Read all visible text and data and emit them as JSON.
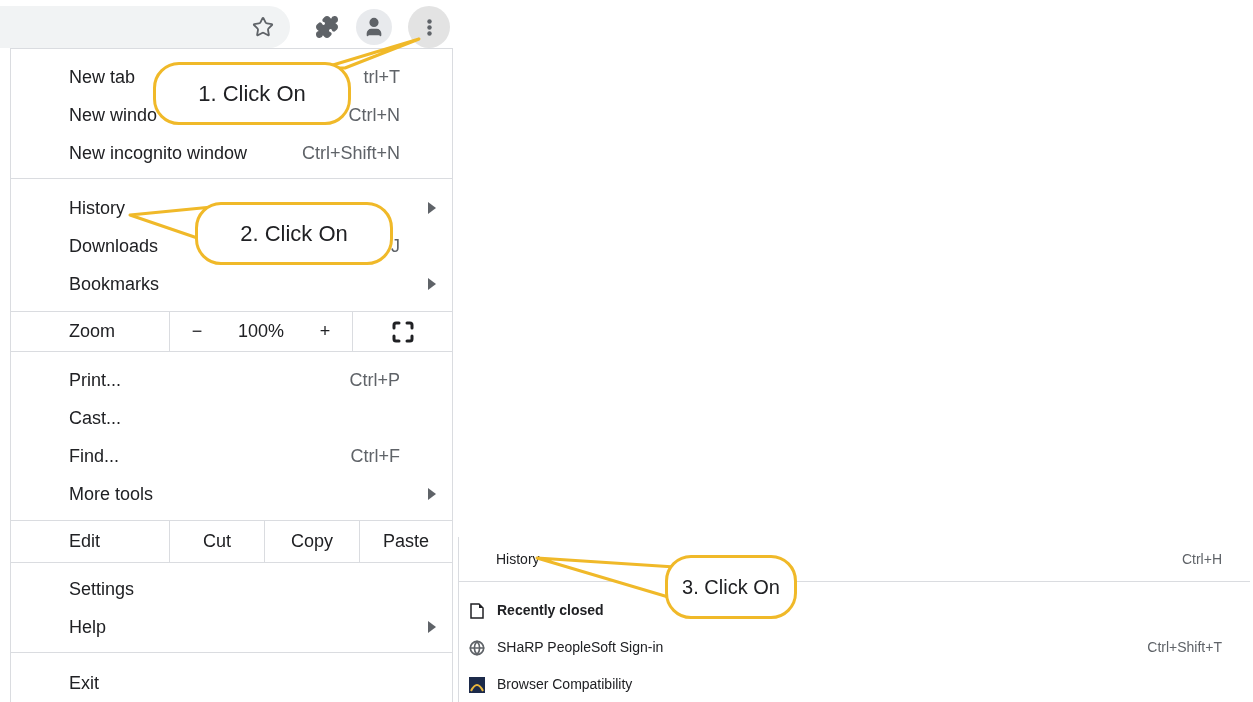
{
  "menu": {
    "sections": [
      {
        "kind": "items",
        "items": [
          {
            "label": "New tab",
            "shortcut": "trl+T",
            "submenu": false
          },
          {
            "label": "New windo",
            "shortcut": "Ctrl+N",
            "submenu": false
          },
          {
            "label": "New incognito window",
            "shortcut": "Ctrl+Shift+N",
            "submenu": false
          }
        ]
      },
      {
        "kind": "items",
        "items": [
          {
            "label": "History",
            "submenu": true
          },
          {
            "label": "Downloads",
            "shortcut": "J",
            "submenu": false
          },
          {
            "label": "Bookmarks",
            "submenu": true
          }
        ]
      },
      {
        "kind": "zoom",
        "label": "Zoom",
        "minus": "−",
        "value": "100%",
        "plus": "+"
      },
      {
        "kind": "items",
        "items": [
          {
            "label": "Print...",
            "shortcut": "Ctrl+P",
            "submenu": false
          },
          {
            "label": "Cast...",
            "submenu": false
          },
          {
            "label": "Find...",
            "shortcut": "Ctrl+F",
            "submenu": false
          },
          {
            "label": "More tools",
            "submenu": true
          }
        ]
      },
      {
        "kind": "edit",
        "label": "Edit",
        "buttons": [
          "Cut",
          "Copy",
          "Paste"
        ]
      },
      {
        "kind": "items",
        "items": [
          {
            "label": "Settings",
            "submenu": false
          },
          {
            "label": "Help",
            "submenu": true
          }
        ]
      },
      {
        "kind": "items",
        "items": [
          {
            "label": "Exit",
            "submenu": false
          }
        ]
      }
    ]
  },
  "history_submenu": {
    "header": {
      "label": "History",
      "shortcut": "Ctrl+H"
    },
    "items": [
      {
        "kind": "heading",
        "label": "Recently closed"
      },
      {
        "kind": "page",
        "label": "SHaRP PeopleSoft Sign-in",
        "shortcut": "Ctrl+Shift+T"
      },
      {
        "kind": "app",
        "label": "Browser Compatibility"
      }
    ]
  },
  "callouts": [
    {
      "text": "1. Click On"
    },
    {
      "text": "2. Click On"
    },
    {
      "text": "3. Click On"
    }
  ]
}
